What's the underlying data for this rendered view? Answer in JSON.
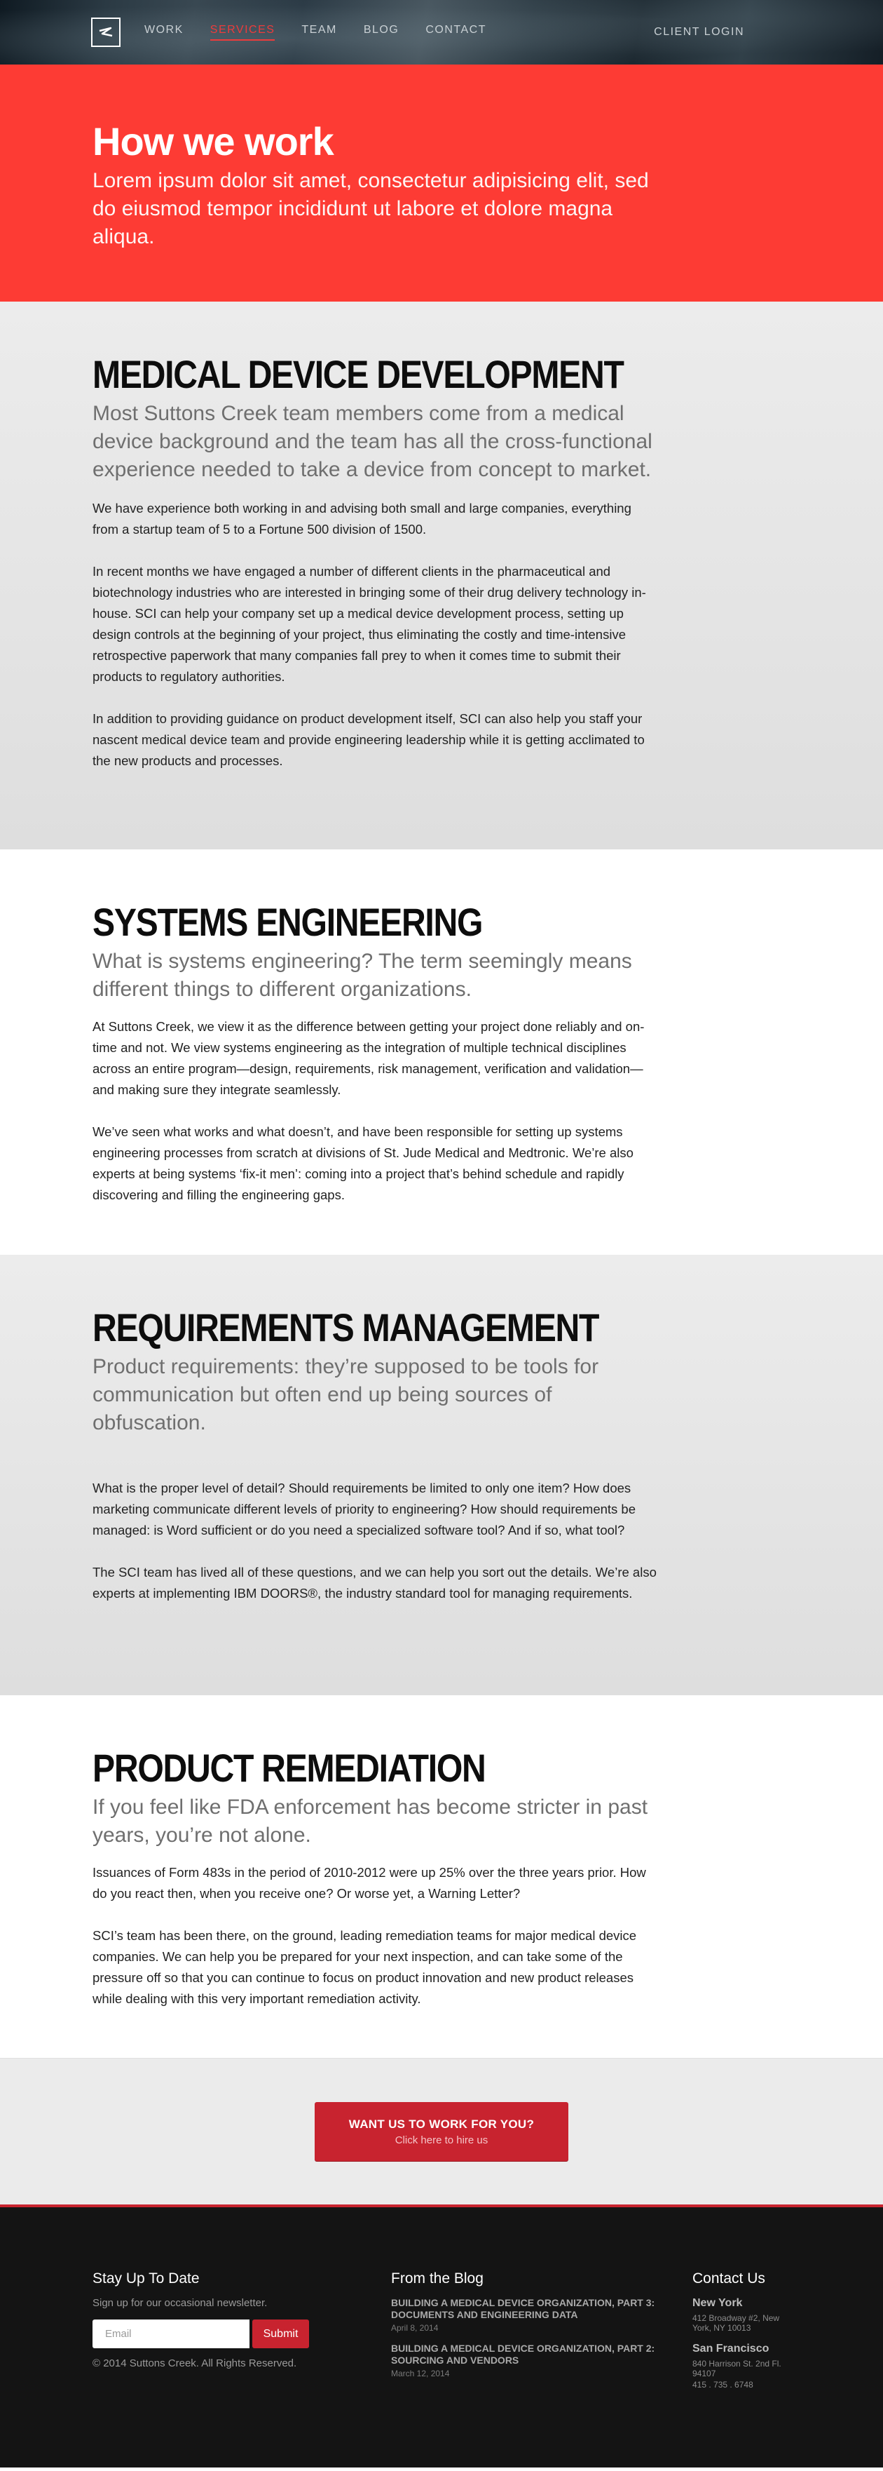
{
  "nav": {
    "logo_alt": "Suttons Creek logo",
    "items": [
      {
        "label": "WORK"
      },
      {
        "label": "SERVICES",
        "active": true
      },
      {
        "label": "TEAM"
      },
      {
        "label": "BLOG"
      },
      {
        "label": "CONTACT"
      }
    ],
    "client_login": "CLIENT LOGIN"
  },
  "hero": {
    "title": "How we work",
    "subtitle": "Lorem ipsum dolor sit amet, consectetur adipisicing elit, sed do eiusmod tempor incididunt ut labore et dolore magna aliqua."
  },
  "sections": [
    {
      "title": "MEDICAL DEVICE DEVELOPMENT",
      "lead": "Most Suttons Creek team members come from a medical device background and the team has all the cross-functional experience needed to take a device from concept to market.",
      "paragraphs": [
        "We have experience both working in and advising both small and large companies, everything from a startup team of 5 to a Fortune 500 division of 1500.",
        "In recent months we have engaged a number of different clients in the pharmaceutical and biotechnology industries who are interested in bringing some of their drug delivery technology in-house. SCI can help your company set up a medical device development process, setting up design controls at the beginning of your project, thus eliminating the costly and time-intensive retrospective paperwork that many companies fall prey to when it comes time to submit their products to regulatory authorities.",
        "In addition to providing guidance on product development itself, SCI can also help you staff your nascent medical device team and provide engineering leadership while it is getting acclimated to the new products and processes."
      ]
    },
    {
      "title": "SYSTEMS ENGINEERING",
      "lead": "What is systems engineering? The term seemingly means different things to different organizations.",
      "paragraphs": [
        "At Suttons Creek, we view it as the difference between getting your project done reliably and on-time and not. We view systems engineering as the integration of multiple technical disciplines across an entire program—design, requirements, risk management, verification and validation—and making sure they integrate seamlessly.",
        "We’ve seen what works and what doesn’t, and have been responsible for setting up systems engineering processes from scratch at divisions of St. Jude Medical and Medtronic. We’re also experts at being systems ‘fix-it men’: coming into a project that’s behind schedule and rapidly discovering and filling the engineering gaps."
      ]
    },
    {
      "title": "REQUIREMENTS MANAGEMENT",
      "lead": "Product requirements: they’re supposed to be tools for communication but often end up being sources of obfuscation.",
      "paragraphs": [
        "What is the proper level of detail? Should requirements be limited to only one item? How does marketing communicate different levels of priority to engineering? How should requirements be managed: is Word sufficient or do you need a specialized software tool? And if so, what tool?",
        "The SCI team has lived all of these questions, and we can help you sort out the details. We’re also experts at implementing IBM DOORS®, the industry standard tool for managing requirements."
      ]
    },
    {
      "title": "PRODUCT REMEDIATION",
      "lead": "If you feel like FDA enforcement has become stricter in past years, you’re not alone.",
      "paragraphs": [
        "Issuances of Form 483s in the period of 2010-2012 were up 25% over the three years prior. How do you react then, when you receive one? Or worse yet, a Warning Letter?",
        "SCI’s team has been there, on the ground, leading remediation teams for major medical device companies. We can help you be prepared for your next inspection, and can take some of the pressure off so that you can continue to focus on product innovation and new product releases while dealing with this very important remediation activity."
      ]
    }
  ],
  "cta": {
    "title": "WANT US TO WORK FOR YOU?",
    "subtitle": "Click here to hire us"
  },
  "footer": {
    "newsletter": {
      "heading": "Stay Up To Date",
      "text": "Sign up for our occasional newsletter.",
      "email_placeholder": "Email",
      "submit_label": "Submit",
      "copyright": "© 2014 Suttons Creek. All Rights Reserved."
    },
    "blog": {
      "heading": "From the Blog",
      "posts": [
        {
          "title": "BUILDING A MEDICAL DEVICE ORGANIZATION, PART 3: DOCUMENTS AND ENGINEERING DATA",
          "date": "April 8, 2014"
        },
        {
          "title": "BUILDING A MEDICAL DEVICE ORGANIZATION, PART 2: SOURCING AND VENDORS",
          "date": "March 12, 2014"
        }
      ]
    },
    "contact": {
      "heading": "Contact Us",
      "offices": [
        {
          "city": "New York",
          "lines": [
            "412 Broadway #2, New York, NY 10013"
          ]
        },
        {
          "city": "San Francisco",
          "lines": [
            "840 Harrison St. 2nd Fl. 94107",
            "415 . 735 . 6748"
          ]
        }
      ]
    }
  },
  "colors": {
    "accent_red": "#fd3b34",
    "button_red": "#c8232f",
    "footer_bg": "#141414"
  }
}
